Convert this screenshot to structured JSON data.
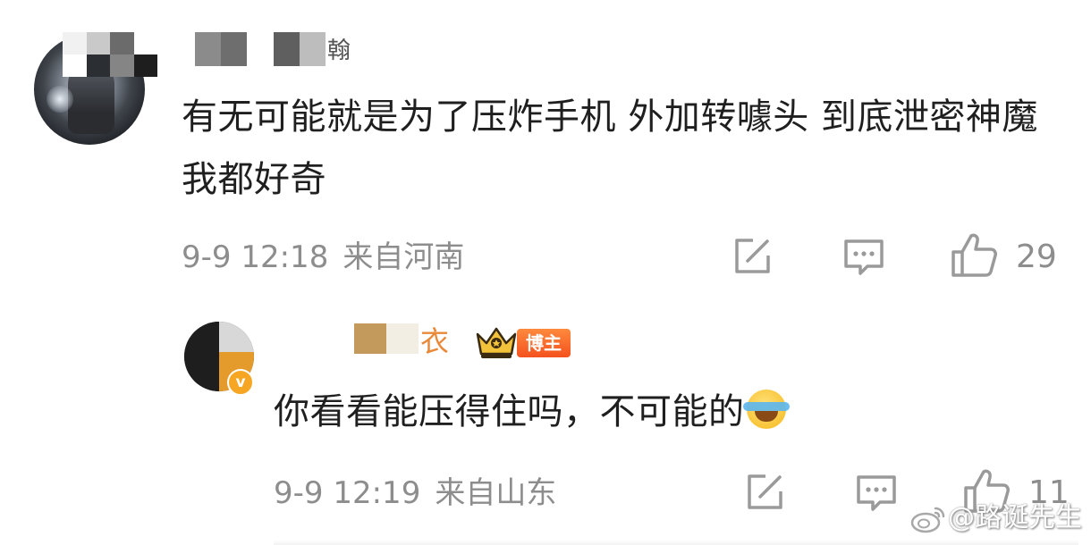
{
  "comment": {
    "author_name_visible_part": "翰",
    "text": "有无可能就是为了压炸手机 外加转噱头  到底泄密神魔我都好奇",
    "date": "9-9 12:18",
    "location": "来自河南",
    "like_count": "29"
  },
  "reply": {
    "author_name_visible_part": "衣",
    "badge_label": "博主",
    "verified_mark": "v",
    "text": "你看看能压得住吗，不可能的",
    "emoji": "laugh-cry-emoji",
    "date": "9-9 12:19",
    "location": "来自山东",
    "like_count": "11"
  },
  "watermark": {
    "text": "@路诞先生"
  },
  "colors": {
    "meta_gray": "#8d8d8d",
    "reply_name_orange": "#e8893a",
    "blogger_badge": "#f4511e",
    "verified_badge": "#f6a623"
  },
  "icons": {
    "share": "edit-share-icon",
    "comment": "comment-bubble-icon",
    "like": "thumbs-up-icon",
    "crown": "crown-icon",
    "weibo": "weibo-logo-icon"
  }
}
